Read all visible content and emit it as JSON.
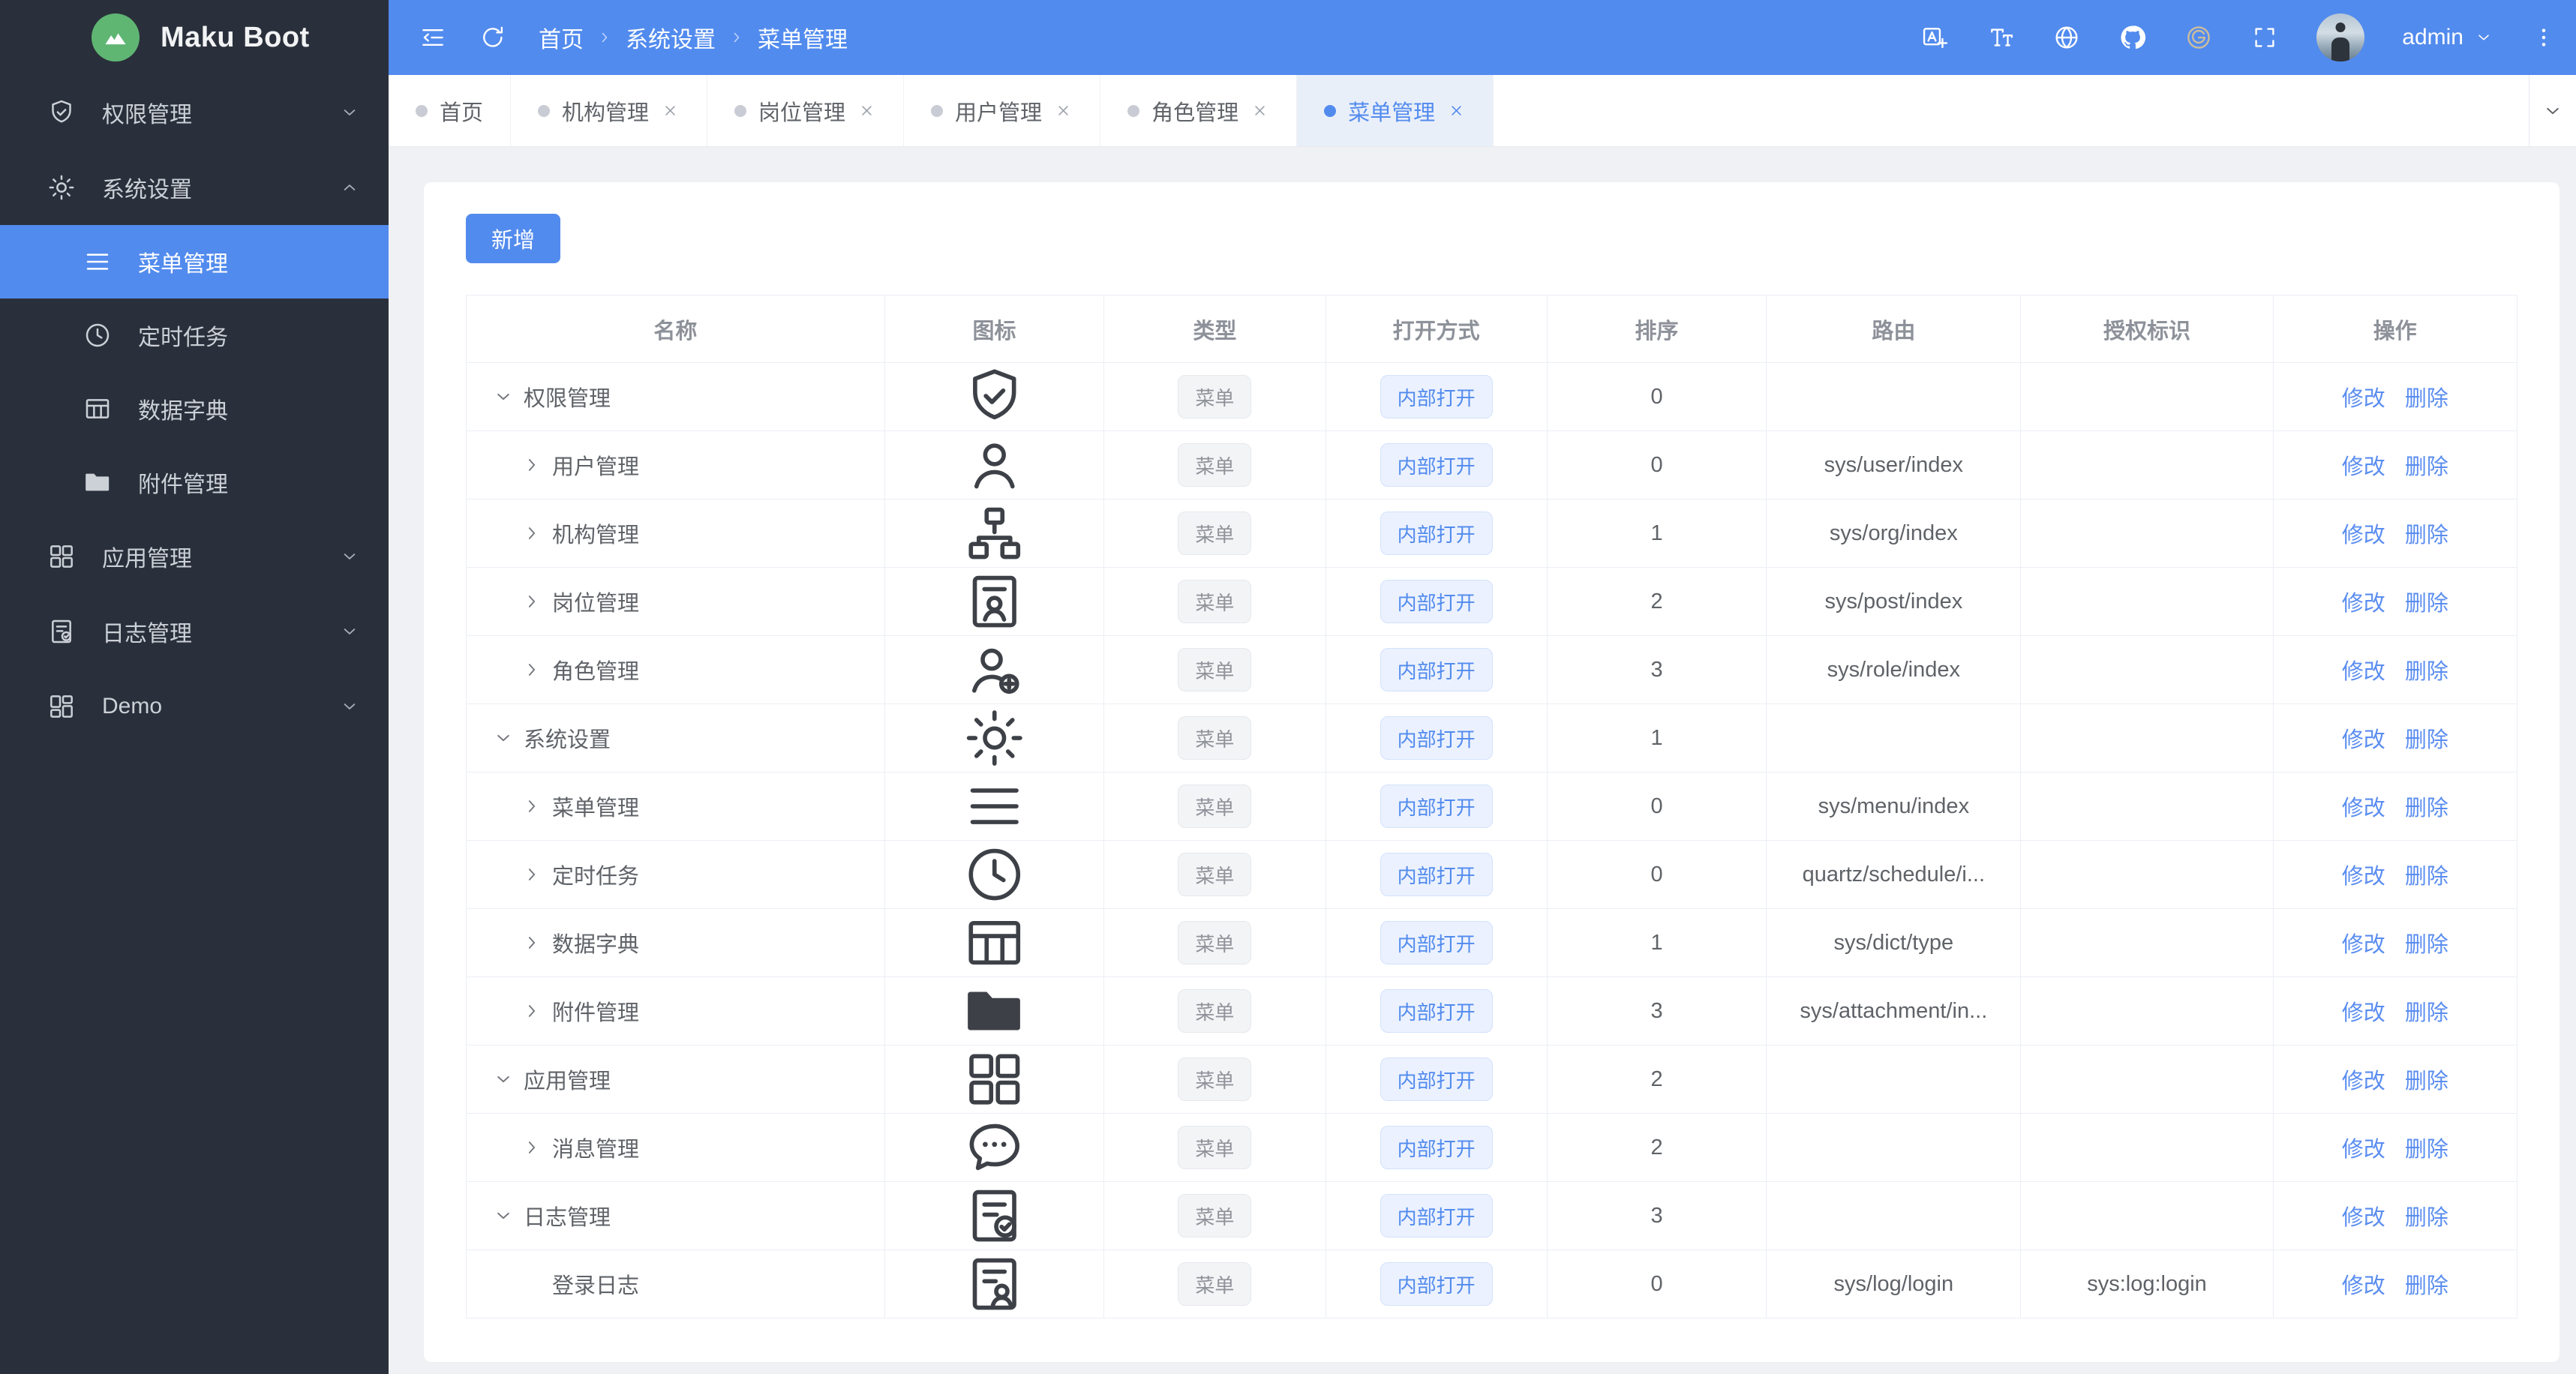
{
  "app": {
    "title": "Maku Boot"
  },
  "colors": {
    "accent": "#528bee",
    "sidebar_bg": "#2a303b",
    "logo_green": "#5fb673",
    "content_bg": "#eff1f4",
    "tag_info_text": "#8f939a",
    "tag_primary_text": "#528bee",
    "link_blue": "#5a8df0"
  },
  "sidebar": {
    "items": [
      {
        "key": "permission",
        "label": "权限管理",
        "icon": "shield-check",
        "chevron": "down"
      },
      {
        "key": "system",
        "label": "系统设置",
        "icon": "gear",
        "chevron": "up",
        "expanded": true,
        "children": [
          {
            "key": "menu",
            "label": "菜单管理",
            "icon": "menu",
            "active": true
          },
          {
            "key": "schedule",
            "label": "定时任务",
            "icon": "clock"
          },
          {
            "key": "dict",
            "label": "数据字典",
            "icon": "table"
          },
          {
            "key": "attachment",
            "label": "附件管理",
            "icon": "folder"
          }
        ]
      },
      {
        "key": "apps",
        "label": "应用管理",
        "icon": "grid",
        "chevron": "down"
      },
      {
        "key": "logs",
        "label": "日志管理",
        "icon": "log",
        "chevron": "down"
      },
      {
        "key": "demo",
        "label": "Demo",
        "icon": "grid2",
        "chevron": "down"
      }
    ]
  },
  "header": {
    "breadcrumb": [
      "首页",
      "系统设置",
      "菜单管理"
    ],
    "action_icons": [
      "translate",
      "font-size",
      "globe",
      "github",
      "gitee",
      "fullscreen"
    ],
    "user": "admin"
  },
  "tabs": [
    {
      "key": "home",
      "label": "首页",
      "closable": false,
      "active": false
    },
    {
      "key": "org",
      "label": "机构管理",
      "closable": true,
      "active": false
    },
    {
      "key": "post",
      "label": "岗位管理",
      "closable": true,
      "active": false
    },
    {
      "key": "user",
      "label": "用户管理",
      "closable": true,
      "active": false
    },
    {
      "key": "role",
      "label": "角色管理",
      "closable": true,
      "active": false
    },
    {
      "key": "menu",
      "label": "菜单管理",
      "closable": true,
      "active": true
    }
  ],
  "toolbar": {
    "add_label": "新增"
  },
  "table": {
    "columns": [
      "名称",
      "图标",
      "类型",
      "打开方式",
      "排序",
      "路由",
      "授权标识",
      "操作"
    ],
    "type_tag": "菜单",
    "open_tag": "内部打开",
    "actions": {
      "edit": "修改",
      "delete": "删除"
    },
    "rows": [
      {
        "name": "权限管理",
        "icon": "shield-check",
        "level": 0,
        "arrow": "down",
        "sort": "0",
        "route": "",
        "perm": ""
      },
      {
        "name": "用户管理",
        "icon": "user",
        "level": 1,
        "arrow": "right",
        "sort": "0",
        "route": "sys/user/index",
        "perm": ""
      },
      {
        "name": "机构管理",
        "icon": "org",
        "level": 1,
        "arrow": "right",
        "sort": "1",
        "route": "sys/org/index",
        "perm": ""
      },
      {
        "name": "岗位管理",
        "icon": "post",
        "level": 1,
        "arrow": "right",
        "sort": "2",
        "route": "sys/post/index",
        "perm": ""
      },
      {
        "name": "角色管理",
        "icon": "role",
        "level": 1,
        "arrow": "right",
        "sort": "3",
        "route": "sys/role/index",
        "perm": ""
      },
      {
        "name": "系统设置",
        "icon": "gear",
        "level": 0,
        "arrow": "down",
        "sort": "1",
        "route": "",
        "perm": ""
      },
      {
        "name": "菜单管理",
        "icon": "menu",
        "level": 1,
        "arrow": "right",
        "sort": "0",
        "route": "sys/menu/index",
        "perm": ""
      },
      {
        "name": "定时任务",
        "icon": "clock",
        "level": 1,
        "arrow": "right",
        "sort": "0",
        "route": "quartz/schedule/i...",
        "perm": ""
      },
      {
        "name": "数据字典",
        "icon": "table",
        "level": 1,
        "arrow": "right",
        "sort": "1",
        "route": "sys/dict/type",
        "perm": ""
      },
      {
        "name": "附件管理",
        "icon": "folder",
        "level": 1,
        "arrow": "right",
        "sort": "3",
        "route": "sys/attachment/in...",
        "perm": ""
      },
      {
        "name": "应用管理",
        "icon": "grid",
        "level": 0,
        "arrow": "down",
        "sort": "2",
        "route": "",
        "perm": ""
      },
      {
        "name": "消息管理",
        "icon": "message",
        "level": 1,
        "arrow": "right",
        "sort": "2",
        "route": "",
        "perm": ""
      },
      {
        "name": "日志管理",
        "icon": "log",
        "level": 0,
        "arrow": "down",
        "sort": "3",
        "route": "",
        "perm": ""
      },
      {
        "name": "登录日志",
        "icon": "login-log",
        "level": 1,
        "arrow": "none",
        "sort": "0",
        "route": "sys/log/login",
        "perm": "sys:log:login"
      }
    ]
  }
}
